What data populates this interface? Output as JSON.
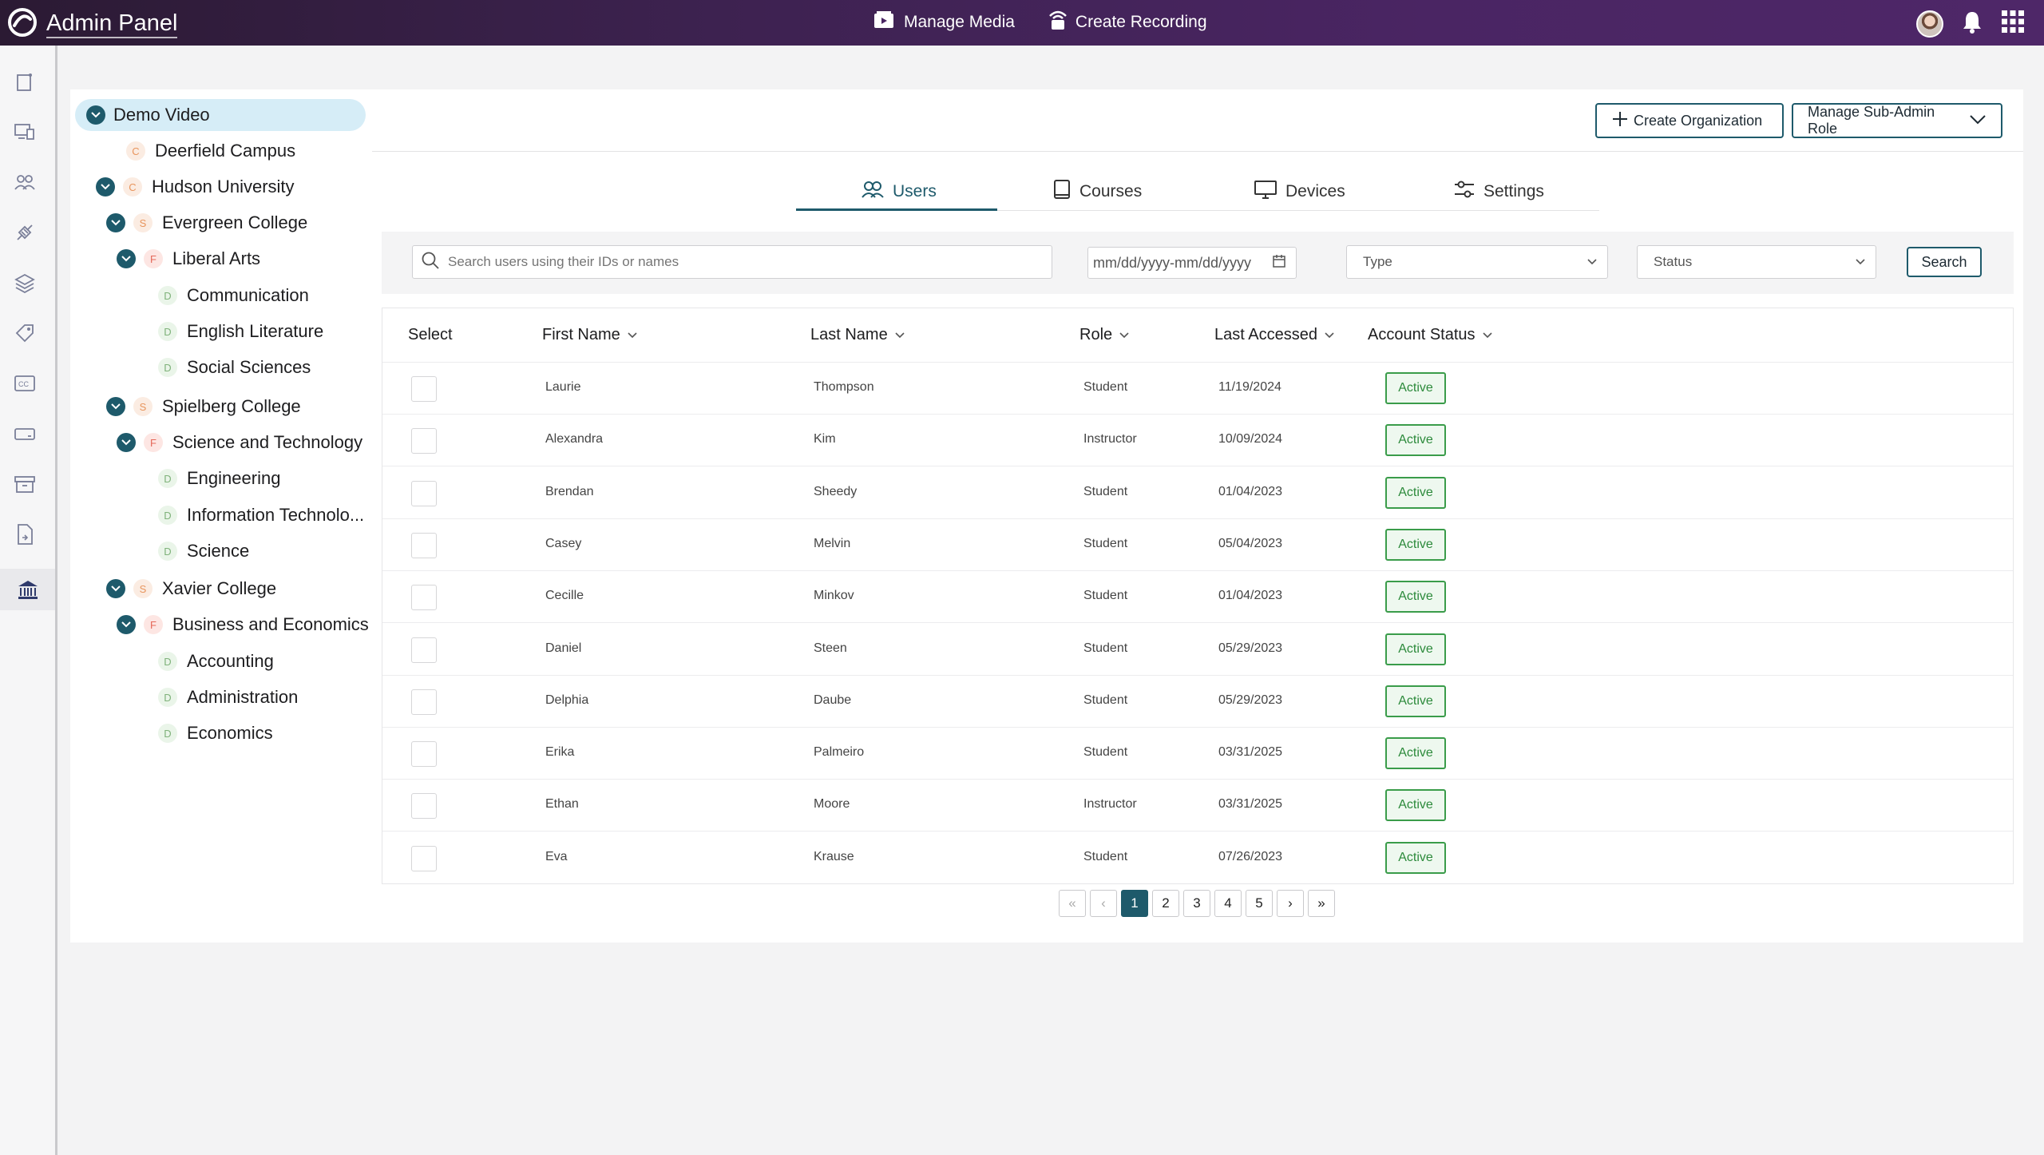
{
  "app": {
    "title": "Admin Panel"
  },
  "topnav": [
    {
      "label": "Manage Media",
      "icon": "media-icon"
    },
    {
      "label": "Create Recording",
      "icon": "recording-icon"
    }
  ],
  "header": {
    "create_org": "Create Organization",
    "manage_sub_admin": "Manage Sub-Admin Role"
  },
  "tree": [
    {
      "label": "Demo Video",
      "badge": "",
      "level": 0,
      "expanded": true,
      "selected": true
    },
    {
      "label": "Deerfield Campus",
      "badge": "C",
      "level": 1
    },
    {
      "label": "Hudson University",
      "badge": "C",
      "level": 1,
      "expanded": true
    },
    {
      "label": "Evergreen College",
      "badge": "S",
      "level": 2,
      "expanded": true
    },
    {
      "label": "Liberal Arts",
      "badge": "F",
      "level": 3,
      "expanded": true
    },
    {
      "label": "Communication",
      "badge": "D",
      "level": 4
    },
    {
      "label": "English Literature",
      "badge": "D",
      "level": 4
    },
    {
      "label": "Social Sciences",
      "badge": "D",
      "level": 4
    },
    {
      "label": "Spielberg College",
      "badge": "S",
      "level": 2,
      "expanded": true
    },
    {
      "label": "Science and Technology",
      "badge": "F",
      "level": 3,
      "expanded": true
    },
    {
      "label": "Engineering",
      "badge": "D",
      "level": 4
    },
    {
      "label": "Information Technolo...",
      "badge": "D",
      "level": 4
    },
    {
      "label": "Science",
      "badge": "D",
      "level": 4
    },
    {
      "label": "Xavier College",
      "badge": "S",
      "level": 2,
      "expanded": true
    },
    {
      "label": "Business and Economics",
      "badge": "F",
      "level": 3,
      "expanded": true
    },
    {
      "label": "Accounting",
      "badge": "D",
      "level": 4
    },
    {
      "label": "Administration",
      "badge": "D",
      "level": 4
    },
    {
      "label": "Economics",
      "badge": "D",
      "level": 4
    }
  ],
  "tabs": [
    {
      "label": "Users",
      "icon": "users-icon",
      "active": true
    },
    {
      "label": "Courses",
      "icon": "book-icon",
      "active": false
    },
    {
      "label": "Devices",
      "icon": "monitor-icon",
      "active": false
    },
    {
      "label": "Settings",
      "icon": "sliders-icon",
      "active": false
    }
  ],
  "filters": {
    "search_placeholder": "Search users using their IDs or names",
    "date_placeholder": "mm/dd/yyyy-mm/dd/yyyy",
    "type": "Type",
    "status": "Status",
    "search_button": "Search"
  },
  "table": {
    "columns": [
      "Select",
      "First Name",
      "Last Name",
      "Role",
      "Last Accessed",
      "Account Status"
    ],
    "rows": [
      {
        "first": "Laurie",
        "last": "Thompson",
        "role": "Student",
        "accessed": "11/19/2024",
        "status": "Active"
      },
      {
        "first": "Alexandra",
        "last": "Kim",
        "role": "Instructor",
        "accessed": "10/09/2024",
        "status": "Active"
      },
      {
        "first": "Brendan",
        "last": "Sheedy",
        "role": "Student",
        "accessed": "01/04/2023",
        "status": "Active"
      },
      {
        "first": "Casey",
        "last": "Melvin",
        "role": "Student",
        "accessed": "05/04/2023",
        "status": "Active"
      },
      {
        "first": "Cecille",
        "last": "Minkov",
        "role": "Student",
        "accessed": "01/04/2023",
        "status": "Active"
      },
      {
        "first": "Daniel",
        "last": "Steen",
        "role": "Student",
        "accessed": "05/29/2023",
        "status": "Active"
      },
      {
        "first": "Delphia",
        "last": "Daube",
        "role": "Student",
        "accessed": "05/29/2023",
        "status": "Active"
      },
      {
        "first": "Erika",
        "last": "Palmeiro",
        "role": "Student",
        "accessed": "03/31/2025",
        "status": "Active"
      },
      {
        "first": "Ethan",
        "last": "Moore",
        "role": "Instructor",
        "accessed": "03/31/2025",
        "status": "Active"
      },
      {
        "first": "Eva",
        "last": "Krause",
        "role": "Student",
        "accessed": "07/26/2023",
        "status": "Active"
      }
    ]
  },
  "pagination": {
    "first": "«",
    "prev": "‹",
    "pages": [
      "1",
      "2",
      "3",
      "4",
      "5"
    ],
    "current": "1",
    "next": "›",
    "last": "»"
  },
  "colors": {
    "accent": "#1e5a6b",
    "topbar": "#4a2563",
    "active_status": "#3a9c4a"
  }
}
